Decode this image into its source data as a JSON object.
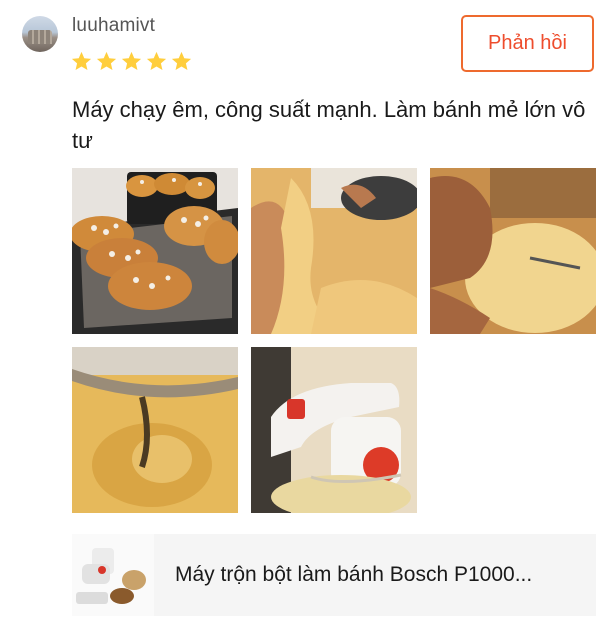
{
  "review": {
    "username": "luuhamivt",
    "rating": 5,
    "rating_max": 5,
    "text": "Máy chạy êm, công suất mạnh. Làm bánh mẻ lớn vô tư"
  },
  "actions": {
    "reply_label": "Phản hồi"
  },
  "photos": [
    "baked-buns-tray",
    "dough-stretching",
    "dough-kneading",
    "dough-in-mixer-bowl",
    "white-stand-mixer"
  ],
  "product": {
    "name": "Máy trộn bột làm bánh Bosch P1000..."
  },
  "colors": {
    "accent": "#ee4d2d",
    "star": "#ffce3d",
    "card_bg": "#f5f5f5"
  }
}
